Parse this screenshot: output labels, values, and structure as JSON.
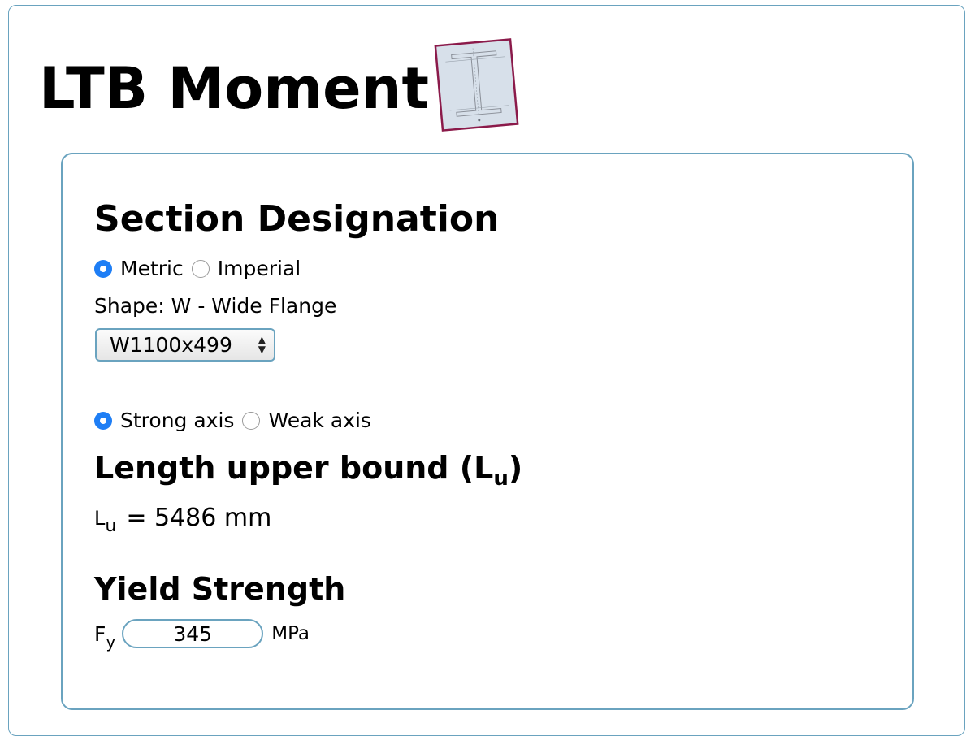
{
  "header": {
    "title": "LTB Moment",
    "logo_icon": "i-beam-section-icon"
  },
  "section": {
    "heading": "Section Designation",
    "units": [
      {
        "label": "Metric",
        "selected": true
      },
      {
        "label": "Imperial",
        "selected": false
      }
    ],
    "shape_label": "Shape: W - Wide Flange",
    "shape_value": "W1100x499"
  },
  "axis": {
    "options": [
      {
        "label": "Strong axis",
        "selected": true
      },
      {
        "label": "Weak axis",
        "selected": false
      }
    ]
  },
  "length": {
    "heading": "Length upper bound (L",
    "heading_sub": "u",
    "heading_close": ")",
    "symbol": "L",
    "symbol_sub": "u",
    "equals": "= 5486 mm"
  },
  "yield": {
    "heading": "Yield Strength",
    "symbol": "F",
    "symbol_sub": "y",
    "value": "345",
    "unit": "MPa"
  },
  "colors": {
    "accent": "#1e7ef5",
    "border": "#6aa3bf",
    "logo_border": "#8b1a4a"
  }
}
